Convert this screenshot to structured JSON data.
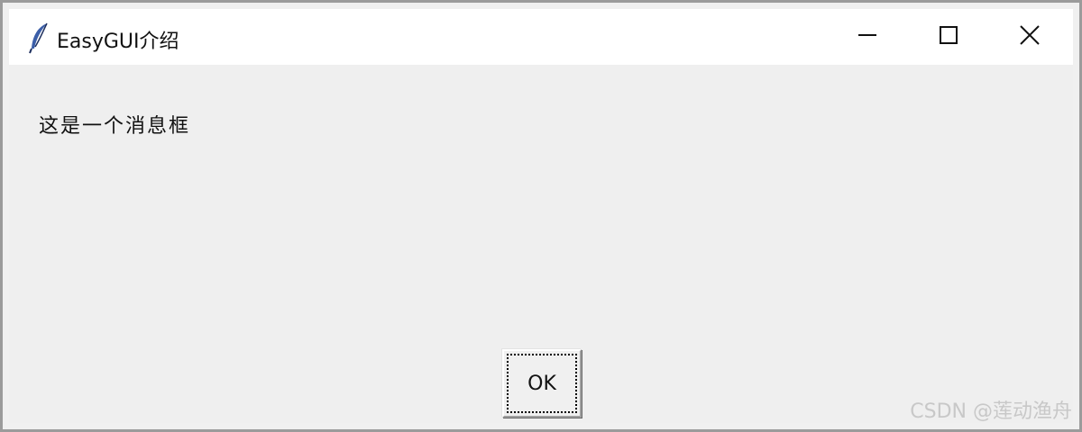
{
  "window": {
    "title": "EasyGUI介绍",
    "app_icon": "feather-icon",
    "controls": {
      "minimize_icon": "minimize-icon",
      "maximize_icon": "maximize-icon",
      "close_icon": "close-icon"
    }
  },
  "dialog": {
    "message": "这是一个消息框",
    "ok_label": "OK"
  },
  "watermark": {
    "text": "CSDN @莲动渔舟"
  },
  "colors": {
    "titlebar_bg": "#ffffff",
    "content_bg": "#efefef",
    "frame_border": "#9b9b9b",
    "text": "#111111"
  }
}
